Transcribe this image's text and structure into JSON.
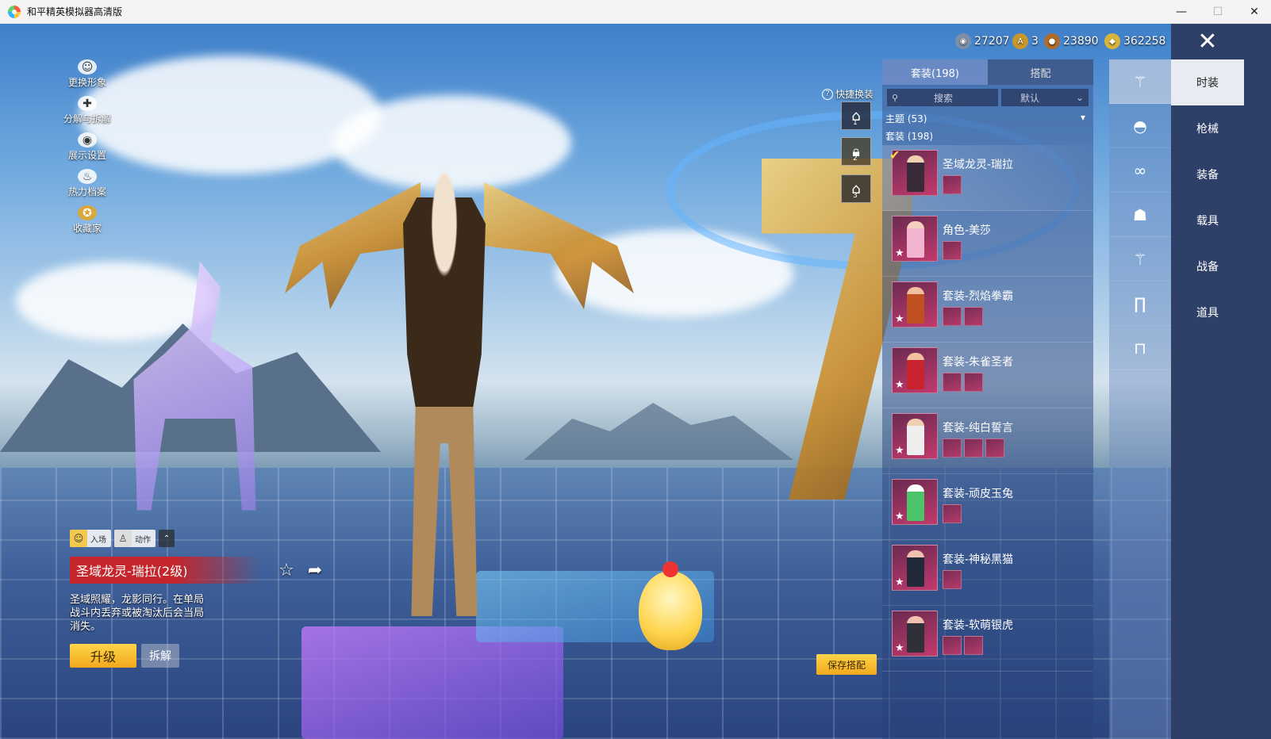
{
  "window": {
    "title": "和平精英模拟器高清版",
    "min": "—",
    "max": "☐",
    "close": "✕"
  },
  "currency": [
    {
      "value": "27207",
      "icon": "medal-coin",
      "color": "#7c8fa8",
      "glyph": "◉"
    },
    {
      "value": "3",
      "icon": "gold-a-coin",
      "color": "#c9962a",
      "glyph": "A"
    },
    {
      "value": "23890",
      "icon": "bronze-coin",
      "color": "#b06c2a",
      "glyph": "●"
    },
    {
      "value": "362258",
      "icon": "diamond-coin",
      "color": "#d8b53a",
      "glyph": "◆"
    }
  ],
  "close_icon": "✕",
  "left_menu": [
    {
      "label": "更换形象",
      "icon": "avatar-icon",
      "glyph": "☺"
    },
    {
      "label": "分解与拆解",
      "icon": "puzzle-icon",
      "glyph": "✚"
    },
    {
      "label": "展示设置",
      "icon": "eye-icon",
      "glyph": "◉"
    },
    {
      "label": "热力档案",
      "icon": "flame-icon",
      "glyph": "♨"
    },
    {
      "label": "收藏家",
      "icon": "collector-badge-icon",
      "glyph": "✪"
    }
  ],
  "mode": {
    "entry": "入场",
    "action": "动作",
    "up": "⌃"
  },
  "skin": {
    "name": "圣域龙灵-瑞拉(2级)",
    "desc": "圣域照耀，龙影同行。在单局战斗内丢弃或被淘汰后会当局消失。",
    "upgrade": "升级",
    "disassemble": "拆解",
    "fav_glyph": "☆",
    "share_glyph": "➦"
  },
  "quick_swap": {
    "label": "快捷换装",
    "help": "?",
    "slots": [
      "1",
      "2",
      "3"
    ]
  },
  "save_label": "保存搭配",
  "panel": {
    "tabs": [
      "套装(198)",
      "搭配"
    ],
    "search_label": "搜索",
    "sort_label": "默认",
    "theme_label": "主题 (53)",
    "suit_count": "套装 (198)",
    "items": [
      {
        "name": "圣域龙灵-瑞拉",
        "parts": 1
      },
      {
        "name": "角色-美莎",
        "parts": 1
      },
      {
        "name": "套装-烈焰拳霸",
        "parts": 2
      },
      {
        "name": "套装-朱雀圣者",
        "parts": 2
      },
      {
        "name": "套装-纯白誓言",
        "parts": 3
      },
      {
        "name": "套装-顽皮玉兔",
        "parts": 1
      },
      {
        "name": "套装-神秘黑猫",
        "parts": 1
      },
      {
        "name": "套装-软萌银虎",
        "parts": 2
      }
    ]
  },
  "icon_strip": [
    {
      "icon": "outfit-icon",
      "glyph": "⚚"
    },
    {
      "icon": "cap-icon",
      "glyph": "◓"
    },
    {
      "icon": "glasses-icon",
      "glyph": "∞"
    },
    {
      "icon": "mask-icon",
      "glyph": "☗"
    },
    {
      "icon": "top-icon",
      "glyph": "⚚"
    },
    {
      "icon": "pants-icon",
      "glyph": "∏"
    },
    {
      "icon": "shoes-icon",
      "glyph": "⊓"
    }
  ],
  "categories": [
    "时装",
    "枪械",
    "装备",
    "载具",
    "战备",
    "道具"
  ]
}
